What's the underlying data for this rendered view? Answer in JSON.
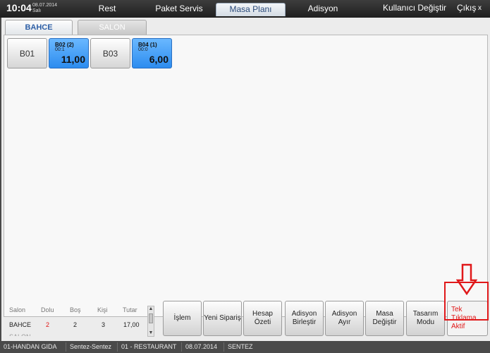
{
  "header": {
    "time": "10:04",
    "date": "08.07.2014",
    "day": "Salı",
    "nav": [
      "Rest",
      "Paket Servis",
      "Masa Planı",
      "Adisyon"
    ],
    "user_switch": "Kullanıcı Değiştir",
    "logout": "Çıkış",
    "close": "x"
  },
  "tabs": [
    "BAHCE",
    "SALON"
  ],
  "tables": [
    {
      "name": "B01"
    },
    {
      "code": "B02 (2)",
      "time": "00:1",
      "amount": "11,00"
    },
    {
      "name": "B03"
    },
    {
      "code": "B04 (1)",
      "time": "00:0",
      "amount": "6,00"
    }
  ],
  "summary": {
    "headers": [
      "Salon",
      "Dolu",
      "Boş",
      "Kişi",
      "Tutar"
    ],
    "row": [
      "BAHCE",
      "2",
      "2",
      "3",
      "17,00"
    ],
    "next_row_partial": "SALON"
  },
  "actions": [
    "İşlem",
    "Yeni Sipariş",
    "Hesap Özeti",
    "Adisyon Birleştir",
    "Adisyon Ayır",
    "Masa Değiştir",
    "Tasarım Modu",
    "Tek Tıklama Aktif"
  ],
  "status": [
    "01-HANDAN GIDA",
    "Sentez-Sentez",
    "01 - RESTAURANT",
    "08.07.2014",
    "SENTEZ"
  ],
  "colors": {
    "accent_red": "#e01818",
    "busy_table": "#2c8cef",
    "active_tab": "#2d5fa6"
  }
}
